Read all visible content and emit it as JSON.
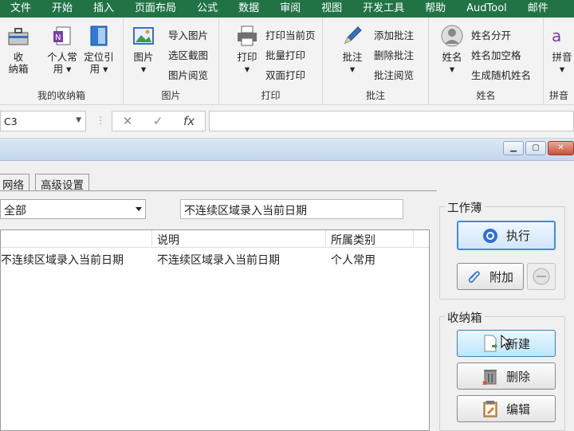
{
  "ribbon_tabs": [
    "文件",
    "开始",
    "插入",
    "页面布局",
    "公式",
    "数据",
    "审阅",
    "视图",
    "开发工具",
    "帮助",
    "AudTool",
    "邮件"
  ],
  "ribbon": {
    "group1": {
      "label": "我的收纳箱",
      "btn_store": "收\n纳箱",
      "btn_personal": "个人常\n用 ▾",
      "btn_locate": "定位引\n用 ▾"
    },
    "group2": {
      "label": "图片",
      "btn_picture": "图片\n▾",
      "import_picture": "导入图片",
      "region_screenshot": "选区截图",
      "picture_view": "图片阅览"
    },
    "group3": {
      "label": "打印",
      "btn_print": "打印\n▾",
      "print_current": "打印当前页",
      "batch_print": "批量打印",
      "duplex_print": "双面打印"
    },
    "group4": {
      "label": "批注",
      "btn_comment": "批注\n▾",
      "add_comment": "添加批注",
      "delete_comment": "删除批注",
      "view_comment": "批注阅览"
    },
    "group5": {
      "label": "姓名",
      "btn_name": "姓名\n▾",
      "split_name": "姓名分开",
      "name_space": "姓名加空格",
      "random_name": "生成随机姓名"
    },
    "group6": {
      "label": "拼音",
      "btn_pinyin": "拼音\n▾"
    }
  },
  "formula_bar": {
    "name_box": "C3",
    "cancel_glyph": "✕",
    "enter_glyph": "✓",
    "fx_label": "fx",
    "formula": ""
  },
  "dialog": {
    "tabs": [
      "网络",
      "高级设置"
    ],
    "category_combo": "全部",
    "search_text": "不连续区域录入当前日期",
    "columns": [
      "",
      "说明",
      "所属类别"
    ],
    "rows": [
      [
        "不连续区域录入当前日期",
        "不连续区域录入当前日期",
        "个人常用"
      ]
    ],
    "workbook_group": "工作薄",
    "btn_execute": "执行",
    "btn_attach": "附加",
    "storage_group": "收纳箱",
    "btn_new": "新建",
    "btn_delete": "删除",
    "btn_edit": "编辑"
  },
  "colors": {
    "ribbon_green": "#217346",
    "accent_blue": "#3a8ee6"
  }
}
